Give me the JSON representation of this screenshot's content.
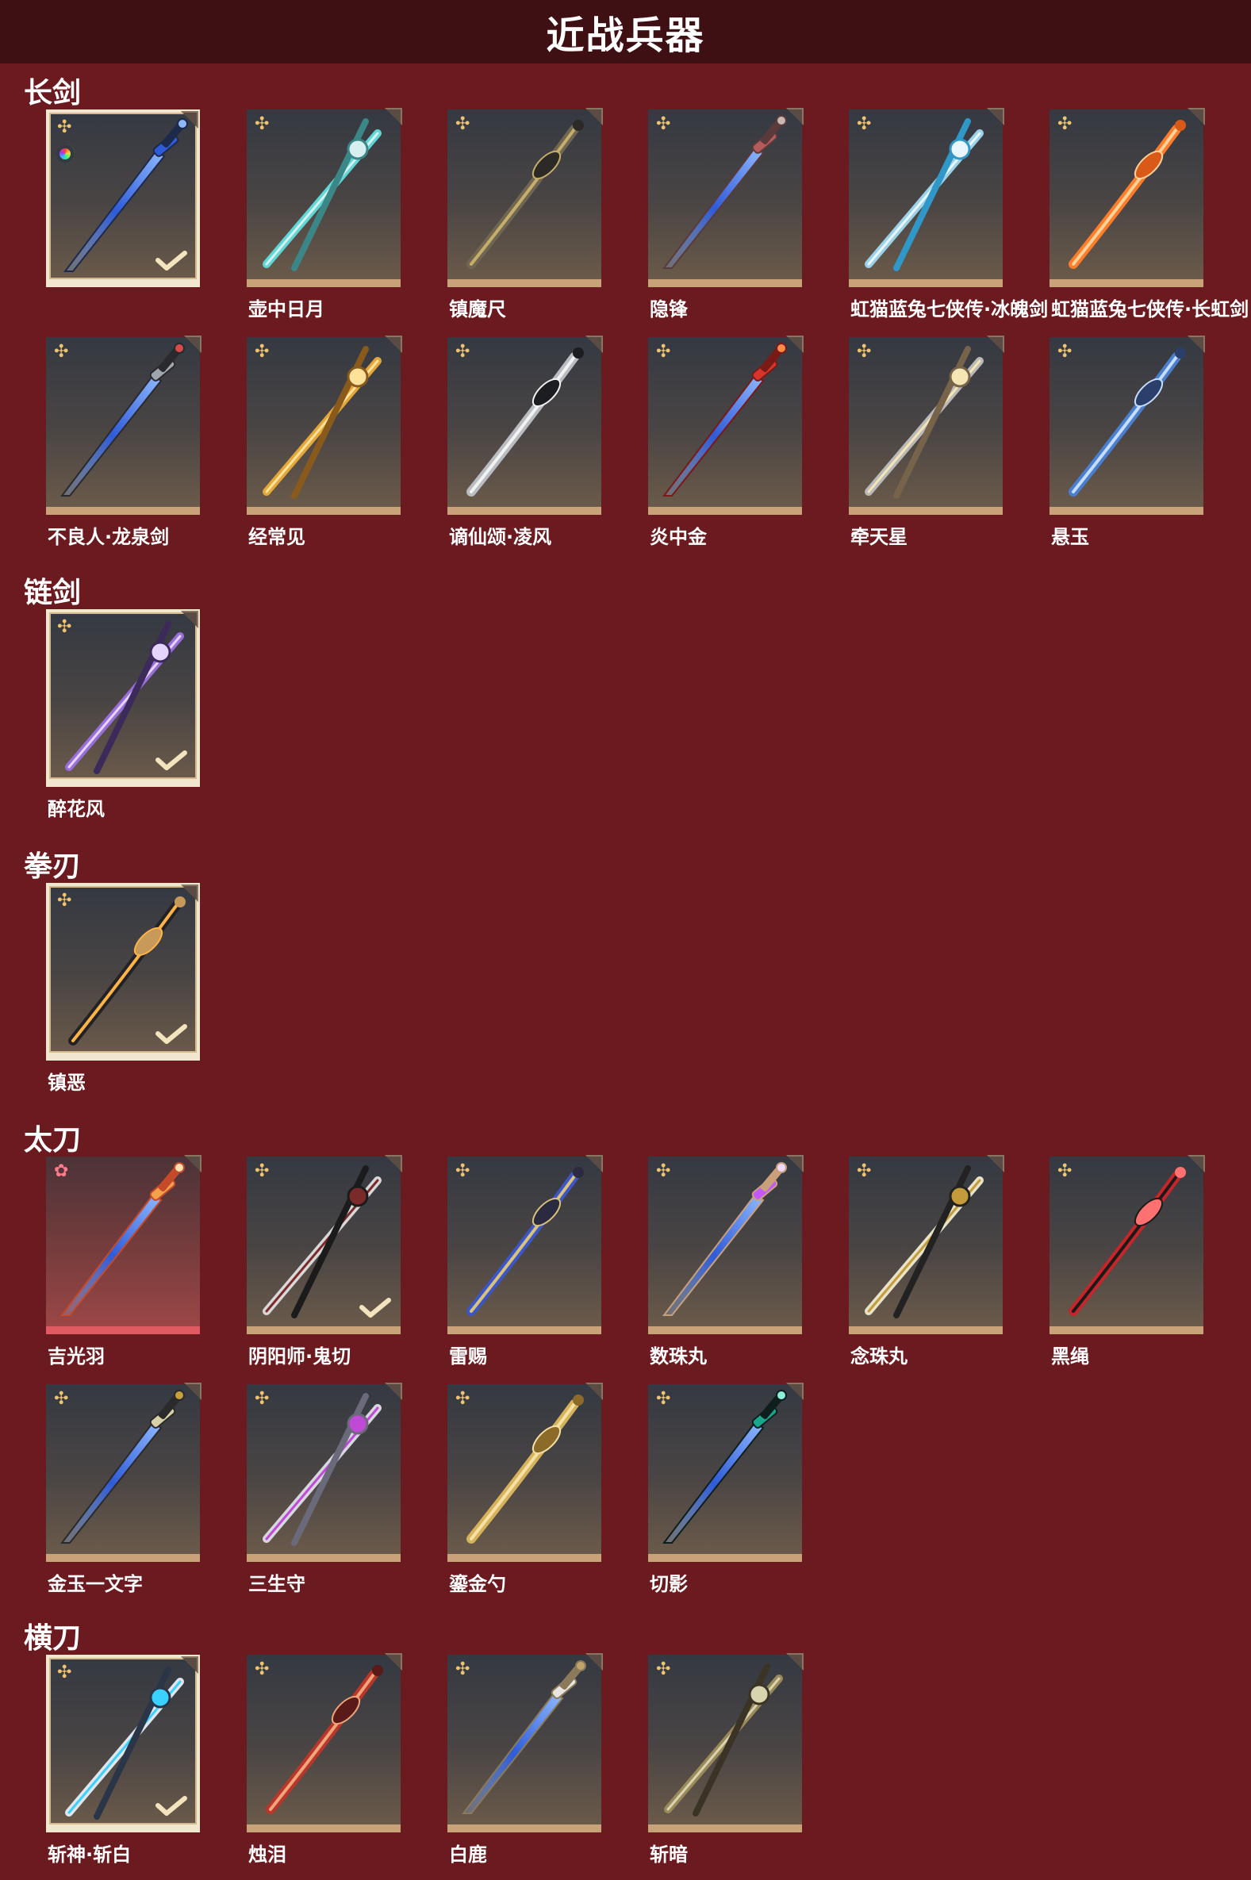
{
  "header": {
    "title": "近战兵器"
  },
  "sections": [
    {
      "title": "长剑",
      "items": [
        {
          "label": "",
          "selected": true,
          "check": true,
          "rainbow": true,
          "colors": [
            "#2f5bd8",
            "#8fb9ff",
            "#1d2a4a"
          ]
        },
        {
          "label": "壶中日月",
          "selected": false,
          "check": false,
          "colors": [
            "#5fd7d6",
            "#d5f0ef",
            "#3b8687"
          ]
        },
        {
          "label": "镇魔尺",
          "selected": false,
          "check": false,
          "colors": [
            "#6f6752",
            "#c6ae6a",
            "#2b2a26"
          ]
        },
        {
          "label": "隐锋",
          "selected": false,
          "check": false,
          "colors": [
            "#b55b5b",
            "#c9b6b0",
            "#5a3a3a"
          ]
        },
        {
          "label": "虹猫蓝兔七侠传·冰魄剑",
          "selected": false,
          "check": false,
          "colors": [
            "#9bd2e8",
            "#e9f6fb",
            "#2f98c8"
          ]
        },
        {
          "label": "虹猫蓝兔七侠传·长虹剑",
          "selected": false,
          "check": false,
          "colors": [
            "#ff7c2a",
            "#ffd29a",
            "#d95a18"
          ]
        },
        {
          "label": "不良人·龙泉剑",
          "selected": false,
          "check": false,
          "colors": [
            "#a1a6ad",
            "#d84a4a",
            "#2a2a2e"
          ]
        },
        {
          "label": "经常见",
          "selected": false,
          "check": false,
          "colors": [
            "#e3a73a",
            "#ffe19a",
            "#8a5a1c"
          ]
        },
        {
          "label": "谪仙颂·凌风",
          "selected": false,
          "check": false,
          "colors": [
            "#b9bcc0",
            "#f2f2f0",
            "#1b1d20"
          ]
        },
        {
          "label": "炎中金",
          "selected": false,
          "check": false,
          "colors": [
            "#d6352c",
            "#ff8a4a",
            "#7a1a17"
          ]
        },
        {
          "label": "牵天星",
          "selected": false,
          "check": false,
          "colors": [
            "#b9b9b9",
            "#f5e5b4",
            "#76634a"
          ]
        },
        {
          "label": "悬玉",
          "selected": false,
          "check": false,
          "colors": [
            "#4a7fd0",
            "#c7ddff",
            "#2a3f6a"
          ]
        }
      ]
    },
    {
      "title": "链剑",
      "items": [
        {
          "label": "醉花风",
          "selected": true,
          "check": true,
          "colors": [
            "#9a6ed8",
            "#e4d5ff",
            "#3b2a5a"
          ]
        }
      ]
    },
    {
      "title": "拳刃",
      "items": [
        {
          "label": "镇恶",
          "selected": true,
          "check": true,
          "colors": [
            "#222226",
            "#ffb347",
            "#c89a5a"
          ]
        }
      ]
    },
    {
      "title": "太刀",
      "items": [
        {
          "label": "吉光羽",
          "selected": false,
          "check": false,
          "red": true,
          "colors": [
            "#f3a14a",
            "#ffe0b0",
            "#c44a2a"
          ]
        },
        {
          "label": "阴阳师·鬼切",
          "selected": false,
          "check": true,
          "colors": [
            "#d8d8d8",
            "#7a2a2a",
            "#1b1b1b"
          ]
        },
        {
          "label": "雷赐",
          "selected": false,
          "check": false,
          "colors": [
            "#3c55c8",
            "#d9c27a",
            "#2a2a40"
          ]
        },
        {
          "label": "数珠丸",
          "selected": false,
          "check": false,
          "colors": [
            "#c457ff",
            "#f0d8ff",
            "#caa07a"
          ]
        },
        {
          "label": "念珠丸",
          "selected": false,
          "check": false,
          "colors": [
            "#e9e3c8",
            "#c39b3a",
            "#222222"
          ]
        },
        {
          "label": "黑绳",
          "selected": false,
          "check": false,
          "colors": [
            "#c6252a",
            "#1a1a1a",
            "#ff7070"
          ]
        },
        {
          "label": "金玉一文字",
          "selected": false,
          "check": false,
          "colors": [
            "#d9cfa8",
            "#c7a03a",
            "#2a2a2a"
          ]
        },
        {
          "label": "三生守",
          "selected": false,
          "check": false,
          "colors": [
            "#d7d7e0",
            "#c04ad6",
            "#6a6a7a"
          ]
        },
        {
          "label": "鎏金勺",
          "selected": false,
          "check": false,
          "colors": [
            "#d6b25a",
            "#f5e0a5",
            "#8c6a2a"
          ]
        },
        {
          "label": "切影",
          "selected": false,
          "check": false,
          "colors": [
            "#18a68d",
            "#8bf0da",
            "#0e1e1c"
          ]
        }
      ]
    },
    {
      "title": "横刀",
      "items": [
        {
          "label": "斩神·斩白",
          "selected": true,
          "check": true,
          "colors": [
            "#dfe6ee",
            "#3ad0ff",
            "#2a3548"
          ]
        },
        {
          "label": "烛泪",
          "selected": false,
          "check": false,
          "colors": [
            "#b8362a",
            "#f0a47a",
            "#5a1a1a"
          ]
        },
        {
          "label": "白鹿",
          "selected": false,
          "check": false,
          "colors": [
            "#e8e6df",
            "#c2a46a",
            "#8a7a5a"
          ]
        },
        {
          "label": "斩暗",
          "selected": false,
          "check": false,
          "colors": [
            "#9a8a5a",
            "#d9d4b0",
            "#3a3326"
          ]
        }
      ]
    }
  ]
}
